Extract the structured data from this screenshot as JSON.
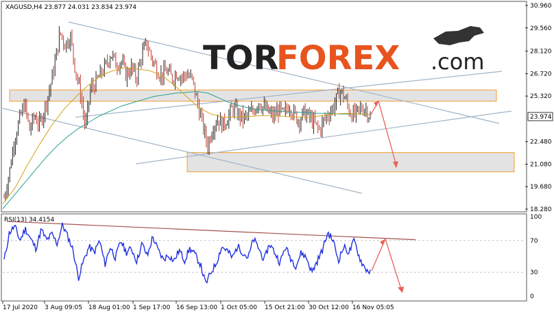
{
  "header": {
    "symbol_line": "XAGUSD,H4  23.877 24.031 23.834 23.974",
    "rsi_line": "RSI(13) 34.4154"
  },
  "logo": {
    "part1": "TOR",
    "part2": "FOREX",
    "suffix": ".com",
    "colors": {
      "tor": "#222222",
      "forex": "#e8541e",
      "com": "#222222"
    }
  },
  "colors": {
    "price_candles_up": "#222222",
    "price_candles_down": "#c0392b",
    "ma_slow": "#2a9d8f",
    "ma_fast": "#d4a017",
    "rsi_line": "#1f2fe0",
    "trendlines": "#9fb3c8",
    "zone_fill": "#d9d9d9",
    "zone_border": "#f0a030",
    "forecast_arrow": "#e8605a",
    "rsi_trendline": "#a0524d"
  },
  "chart_data": [
    {
      "type": "candlestick",
      "title": "XAGUSD,H4",
      "ohlc_last": {
        "open": 23.877,
        "high": 24.031,
        "low": 23.834,
        "close": 23.974
      },
      "current_price_label": "23.974",
      "y_ticks": [
        "30.960",
        "29.560",
        "28.120",
        "26.720",
        "25.320",
        "23.974",
        "22.480",
        "21.080",
        "19.680",
        "18.280"
      ],
      "ylim": [
        18.28,
        30.96
      ],
      "x_ticks": [
        "17 Jul 2020",
        "3 Aug 09:05",
        "18 Aug 01:00",
        "1 Sep 17:00",
        "16 Sep 13:00",
        "1 Oct 05:00",
        "15 Oct 21:00",
        "30 Oct 12:00",
        "16 Nov 05:05"
      ],
      "series": [
        {
          "close_path": [
            19.0,
            20.5,
            22.6,
            23.8,
            24.9,
            23.2,
            24.1,
            23.5,
            24.6,
            25.8,
            27.4,
            29.3,
            28.5,
            29.1,
            27.0,
            25.5,
            23.3,
            25.8,
            26.1,
            26.7,
            27.2,
            28.0,
            27.3,
            27.5,
            26.6,
            27.1,
            26.4,
            27.8,
            28.6,
            27.7,
            27.0,
            26.6,
            26.9,
            26.4,
            26.8,
            26.5,
            26.7,
            26.3,
            24.9,
            23.6,
            22.2,
            23.4,
            23.9,
            23.5,
            24.0,
            24.6,
            24.2,
            23.9,
            24.1,
            24.4,
            25.0,
            24.6,
            24.3,
            24.0,
            24.5,
            24.1,
            24.8,
            24.2,
            23.8,
            24.3,
            24.0,
            23.6,
            23.2,
            23.9,
            24.3,
            24.8,
            25.7,
            25.2,
            24.3,
            24.1,
            24.5,
            24.6,
            24.0
          ]
        },
        {
          "name": "",
          "kind": "moving-average-slow",
          "path": [
            18.3,
            19.1,
            19.9,
            20.7,
            21.5,
            22.2,
            22.8,
            23.3,
            23.7,
            24.1,
            24.4,
            24.7,
            24.9,
            25.1,
            25.3,
            25.4,
            25.5,
            25.55,
            25.6,
            25.5,
            25.2,
            24.9,
            24.7,
            24.55,
            24.45,
            24.4,
            24.35,
            24.3,
            24.3,
            24.25,
            24.25,
            24.2,
            24.2,
            24.2,
            24.15
          ]
        },
        {
          "name": "",
          "kind": "moving-average-fast",
          "path": [
            18.6,
            19.6,
            21.0,
            22.3,
            23.5,
            24.5,
            25.3,
            26.0,
            26.6,
            26.9,
            27.1,
            27.0,
            26.9,
            26.6,
            26.0,
            25.3,
            24.6,
            24.2,
            24.0,
            24.0,
            24.05,
            24.1,
            24.1,
            24.05,
            24.0,
            24.0,
            24.1,
            24.2,
            24.25,
            24.2,
            24.15
          ]
        }
      ],
      "zones": [
        {
          "from": 25.0,
          "to": 25.7
        },
        {
          "from": 20.6,
          "to": 21.8
        }
      ],
      "forecast": [
        24.1,
        25.0,
        21.0
      ]
    },
    {
      "type": "line",
      "title": "RSI(13)",
      "value": 34.4154,
      "y_ticks": [
        "100",
        "70",
        "30",
        "0"
      ],
      "ylim": [
        0,
        100
      ],
      "series": [
        {
          "name": "",
          "values": [
            45,
            80,
            88,
            70,
            85,
            72,
            60,
            84,
            70,
            78,
            66,
            90,
            75,
            58,
            23,
            45,
            62,
            55,
            70,
            40,
            62,
            48,
            70,
            55,
            60,
            44,
            66,
            50,
            75,
            58,
            46,
            52,
            44,
            58,
            45,
            60,
            52,
            40,
            15,
            30,
            42,
            62,
            58,
            48,
            63,
            55,
            48,
            72,
            60,
            45,
            66,
            55,
            42,
            62,
            48,
            38,
            55,
            48,
            30,
            44,
            58,
            80,
            70,
            45,
            62,
            55,
            70,
            48,
            35,
            30
          ]
        }
      ]
    }
  ]
}
